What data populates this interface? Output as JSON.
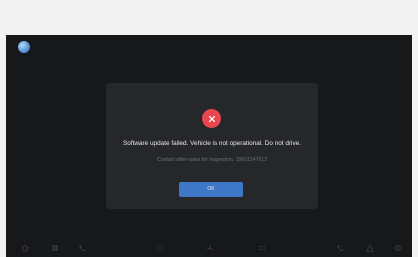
{
  "dialog": {
    "message": "Software update failed. Vehicle is not operational. Do not drive.",
    "submessage": "Contact after-sales for inspection. 19601147613",
    "ok_label": "OK"
  },
  "dock": {
    "icons": [
      "home-icon",
      "apps-icon",
      "phone-icon",
      "music-icon",
      "fan-icon",
      "seat-icon",
      "phone-call-icon",
      "alert-icon",
      "settings-icon"
    ]
  },
  "colors": {
    "screen_bg": "#17181a",
    "dialog_bg": "#25272b",
    "error_red": "#e8474d",
    "button_blue": "#3f77c7",
    "page_bg": "#f2f2f2"
  }
}
